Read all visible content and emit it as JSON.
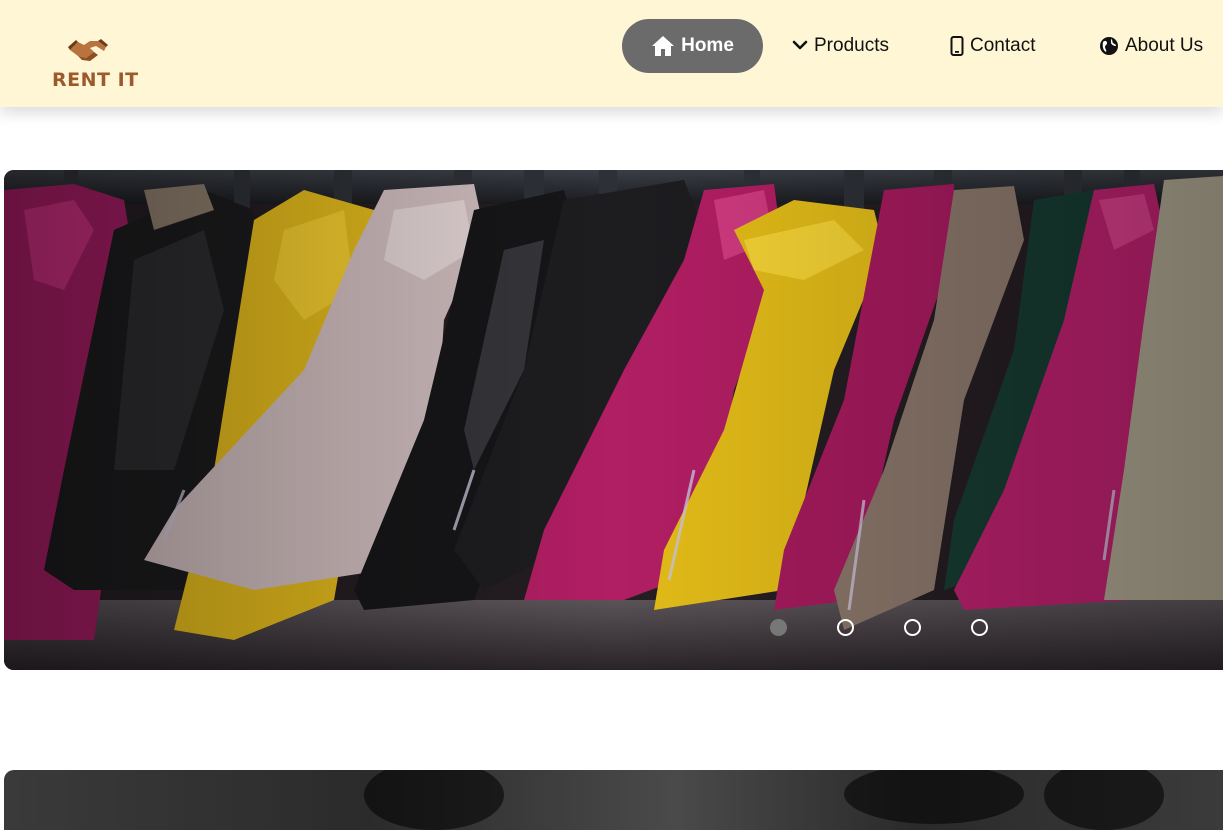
{
  "brand": {
    "name": "RENT IT",
    "logo_icon": "handshake-icon",
    "logo_color": "#9a5a2c"
  },
  "nav": {
    "items": [
      {
        "label": "Home",
        "icon": "home-icon",
        "active": true
      },
      {
        "label": "Products",
        "icon": "chevron-down-icon",
        "active": false
      },
      {
        "label": "Contact",
        "icon": "smartphone-icon",
        "active": false
      },
      {
        "label": "About Us",
        "icon": "globe-icon",
        "active": false
      }
    ]
  },
  "hero": {
    "image": "leather-jackets-on-rack",
    "slide_count": 4,
    "active_slide": 1
  },
  "colors": {
    "header_bg": "#fff6d6",
    "active_nav_bg": "#6b6b6b",
    "dot_active": "#777777"
  }
}
